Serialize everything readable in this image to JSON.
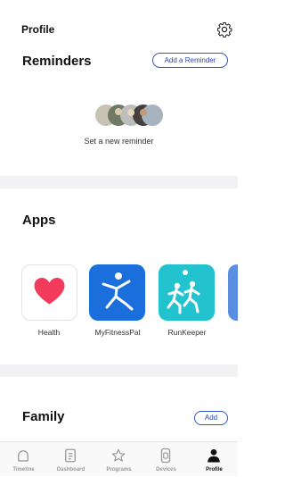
{
  "header": {
    "title": "Profile",
    "settings_icon": "gear-icon"
  },
  "reminders": {
    "title": "Reminders",
    "add_button": "Add a Reminder",
    "empty_text": "Set a new reminder"
  },
  "apps": {
    "title": "Apps",
    "items": [
      {
        "label": "Health",
        "icon": "heart-icon",
        "color": "#f23a5c"
      },
      {
        "label": "MyFitnessPal",
        "icon": "stick-figure-icon",
        "color": "#1a6fdd"
      },
      {
        "label": "RunKeeper",
        "icon": "runners-icon",
        "color": "#23c2cf"
      }
    ]
  },
  "family": {
    "title": "Family",
    "add_button": "Add"
  },
  "tabbar": {
    "tabs": [
      {
        "label": "Timeline",
        "icon": "timeline-icon"
      },
      {
        "label": "Dashboard",
        "icon": "dashboard-icon"
      },
      {
        "label": "Programs",
        "icon": "star-icon"
      },
      {
        "label": "Devices",
        "icon": "device-icon"
      },
      {
        "label": "Profile",
        "icon": "person-icon",
        "active": true
      }
    ]
  },
  "colors": {
    "accent": "#2a47b8",
    "separator": "#f1f1f3"
  }
}
